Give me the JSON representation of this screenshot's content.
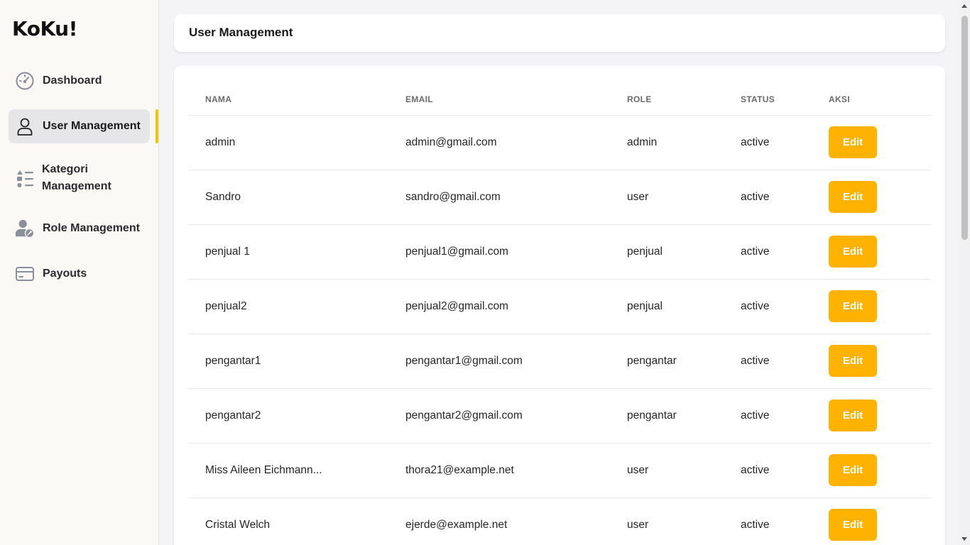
{
  "app": {
    "logo": "KoKu!"
  },
  "sidebar": {
    "items": [
      {
        "label": "Dashboard",
        "icon": "dashboard-gauge-icon",
        "active": false
      },
      {
        "label": "User Management",
        "icon": "user-icon",
        "active": true
      },
      {
        "label": "Kategori Management",
        "icon": "category-list-icon",
        "active": false
      },
      {
        "label": "Role Management",
        "icon": "user-key-icon",
        "active": false
      },
      {
        "label": "Payouts",
        "icon": "credit-card-icon",
        "active": false
      }
    ]
  },
  "header": {
    "title": "User Management"
  },
  "table": {
    "columns": [
      "NAMA",
      "EMAIL",
      "ROLE",
      "STATUS",
      "AKSI"
    ],
    "rows": [
      {
        "nama": "admin",
        "email": "admin@gmail.com",
        "role": "admin",
        "status": "active",
        "action": "Edit"
      },
      {
        "nama": "Sandro",
        "email": "sandro@gmail.com",
        "role": "user",
        "status": "active",
        "action": "Edit"
      },
      {
        "nama": "penjual 1",
        "email": "penjual1@gmail.com",
        "role": "penjual",
        "status": "active",
        "action": "Edit"
      },
      {
        "nama": "penjual2",
        "email": "penjual2@gmail.com",
        "role": "penjual",
        "status": "active",
        "action": "Edit"
      },
      {
        "nama": "pengantar1",
        "email": "pengantar1@gmail.com",
        "role": "pengantar",
        "status": "active",
        "action": "Edit"
      },
      {
        "nama": "pengantar2",
        "email": "pengantar2@gmail.com",
        "role": "pengantar",
        "status": "active",
        "action": "Edit"
      },
      {
        "nama": "Miss Aileen Eichmann...",
        "email": "thora21@example.net",
        "role": "user",
        "status": "active",
        "action": "Edit"
      },
      {
        "nama": "Cristal Welch",
        "email": "ejerde@example.net",
        "role": "user",
        "status": "active",
        "action": "Edit"
      }
    ]
  },
  "colors": {
    "accent": "#ffb300",
    "active_indicator": "#f6c300",
    "sidebar_bg": "#faf9f6",
    "page_bg": "#f4f4f7"
  }
}
